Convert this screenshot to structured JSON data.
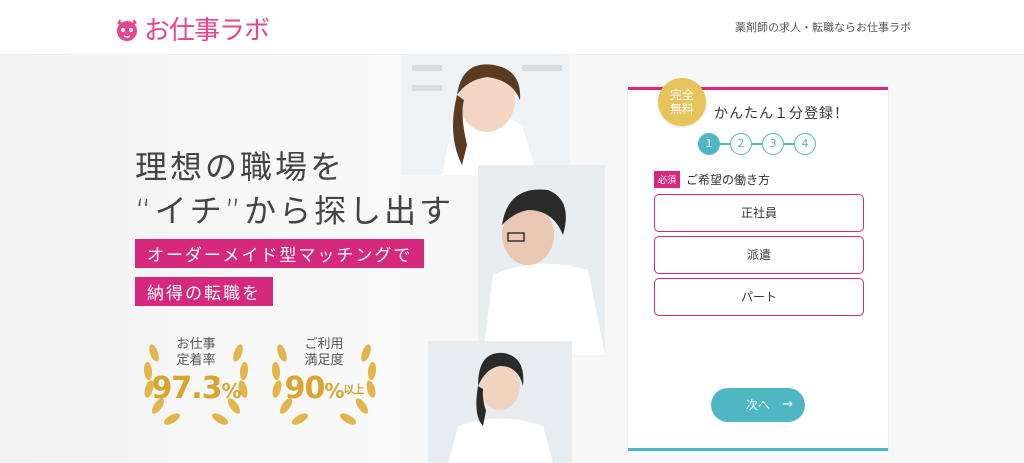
{
  "header": {
    "logo_text": "お仕事ラボ",
    "tagline": "薬剤師の求人・転職ならお仕事ラボ"
  },
  "hero": {
    "headline_line1": "理想の職場を",
    "headline_line2": "“イチ”から探し出す",
    "sub1": "オーダーメイド型マッチングで",
    "sub2": "納得の転職を",
    "badges": [
      {
        "label1": "お仕事",
        "label2": "定着率",
        "value": "97.3",
        "unit": "%"
      },
      {
        "label1": "ご利用",
        "label2": "満足度",
        "value": "90",
        "unit": "%",
        "suffix": "以上"
      }
    ]
  },
  "form": {
    "free_badge_line1": "完全",
    "free_badge_line2": "無料",
    "title": "かんたん１分登録！",
    "steps": [
      "1",
      "2",
      "3",
      "4"
    ],
    "active_step": 1,
    "required_tag": "必須",
    "question": "ご希望の働き方",
    "options": [
      "正社員",
      "派遣",
      "パート"
    ],
    "next_label": "次へ",
    "next_arrow": "→"
  },
  "colors": {
    "pink": "#d6287c",
    "teal": "#4fb6c4",
    "gold": "#d9a430"
  }
}
